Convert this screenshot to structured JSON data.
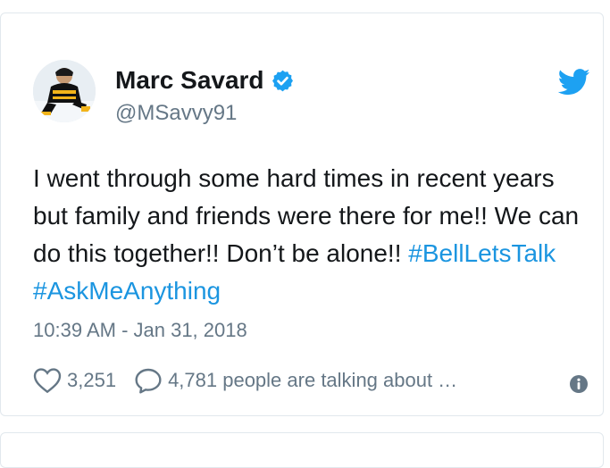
{
  "tweet": {
    "author_name": "Marc Savard",
    "author_handle": "@MSavvy91",
    "text_plain": "I went through some hard times in recent years but family and friends were there for me!! We can do this together!! Don’t be alone!! ",
    "hashtags": [
      "#BellLetsTalk",
      "#AskMeAnything"
    ],
    "timestamp": "10:39 AM - Jan 31, 2018",
    "likes": "3,251",
    "talking": "4,781 people are talking about …",
    "verified_icon": "verified-badge-icon",
    "brand_icon": "twitter-bird-icon"
  },
  "colors": {
    "brand_blue": "#1da1f2",
    "hashtag_blue": "#1b95e0",
    "secondary_text": "#657786",
    "primary_text": "#14171a",
    "border": "#e1e8ed"
  }
}
